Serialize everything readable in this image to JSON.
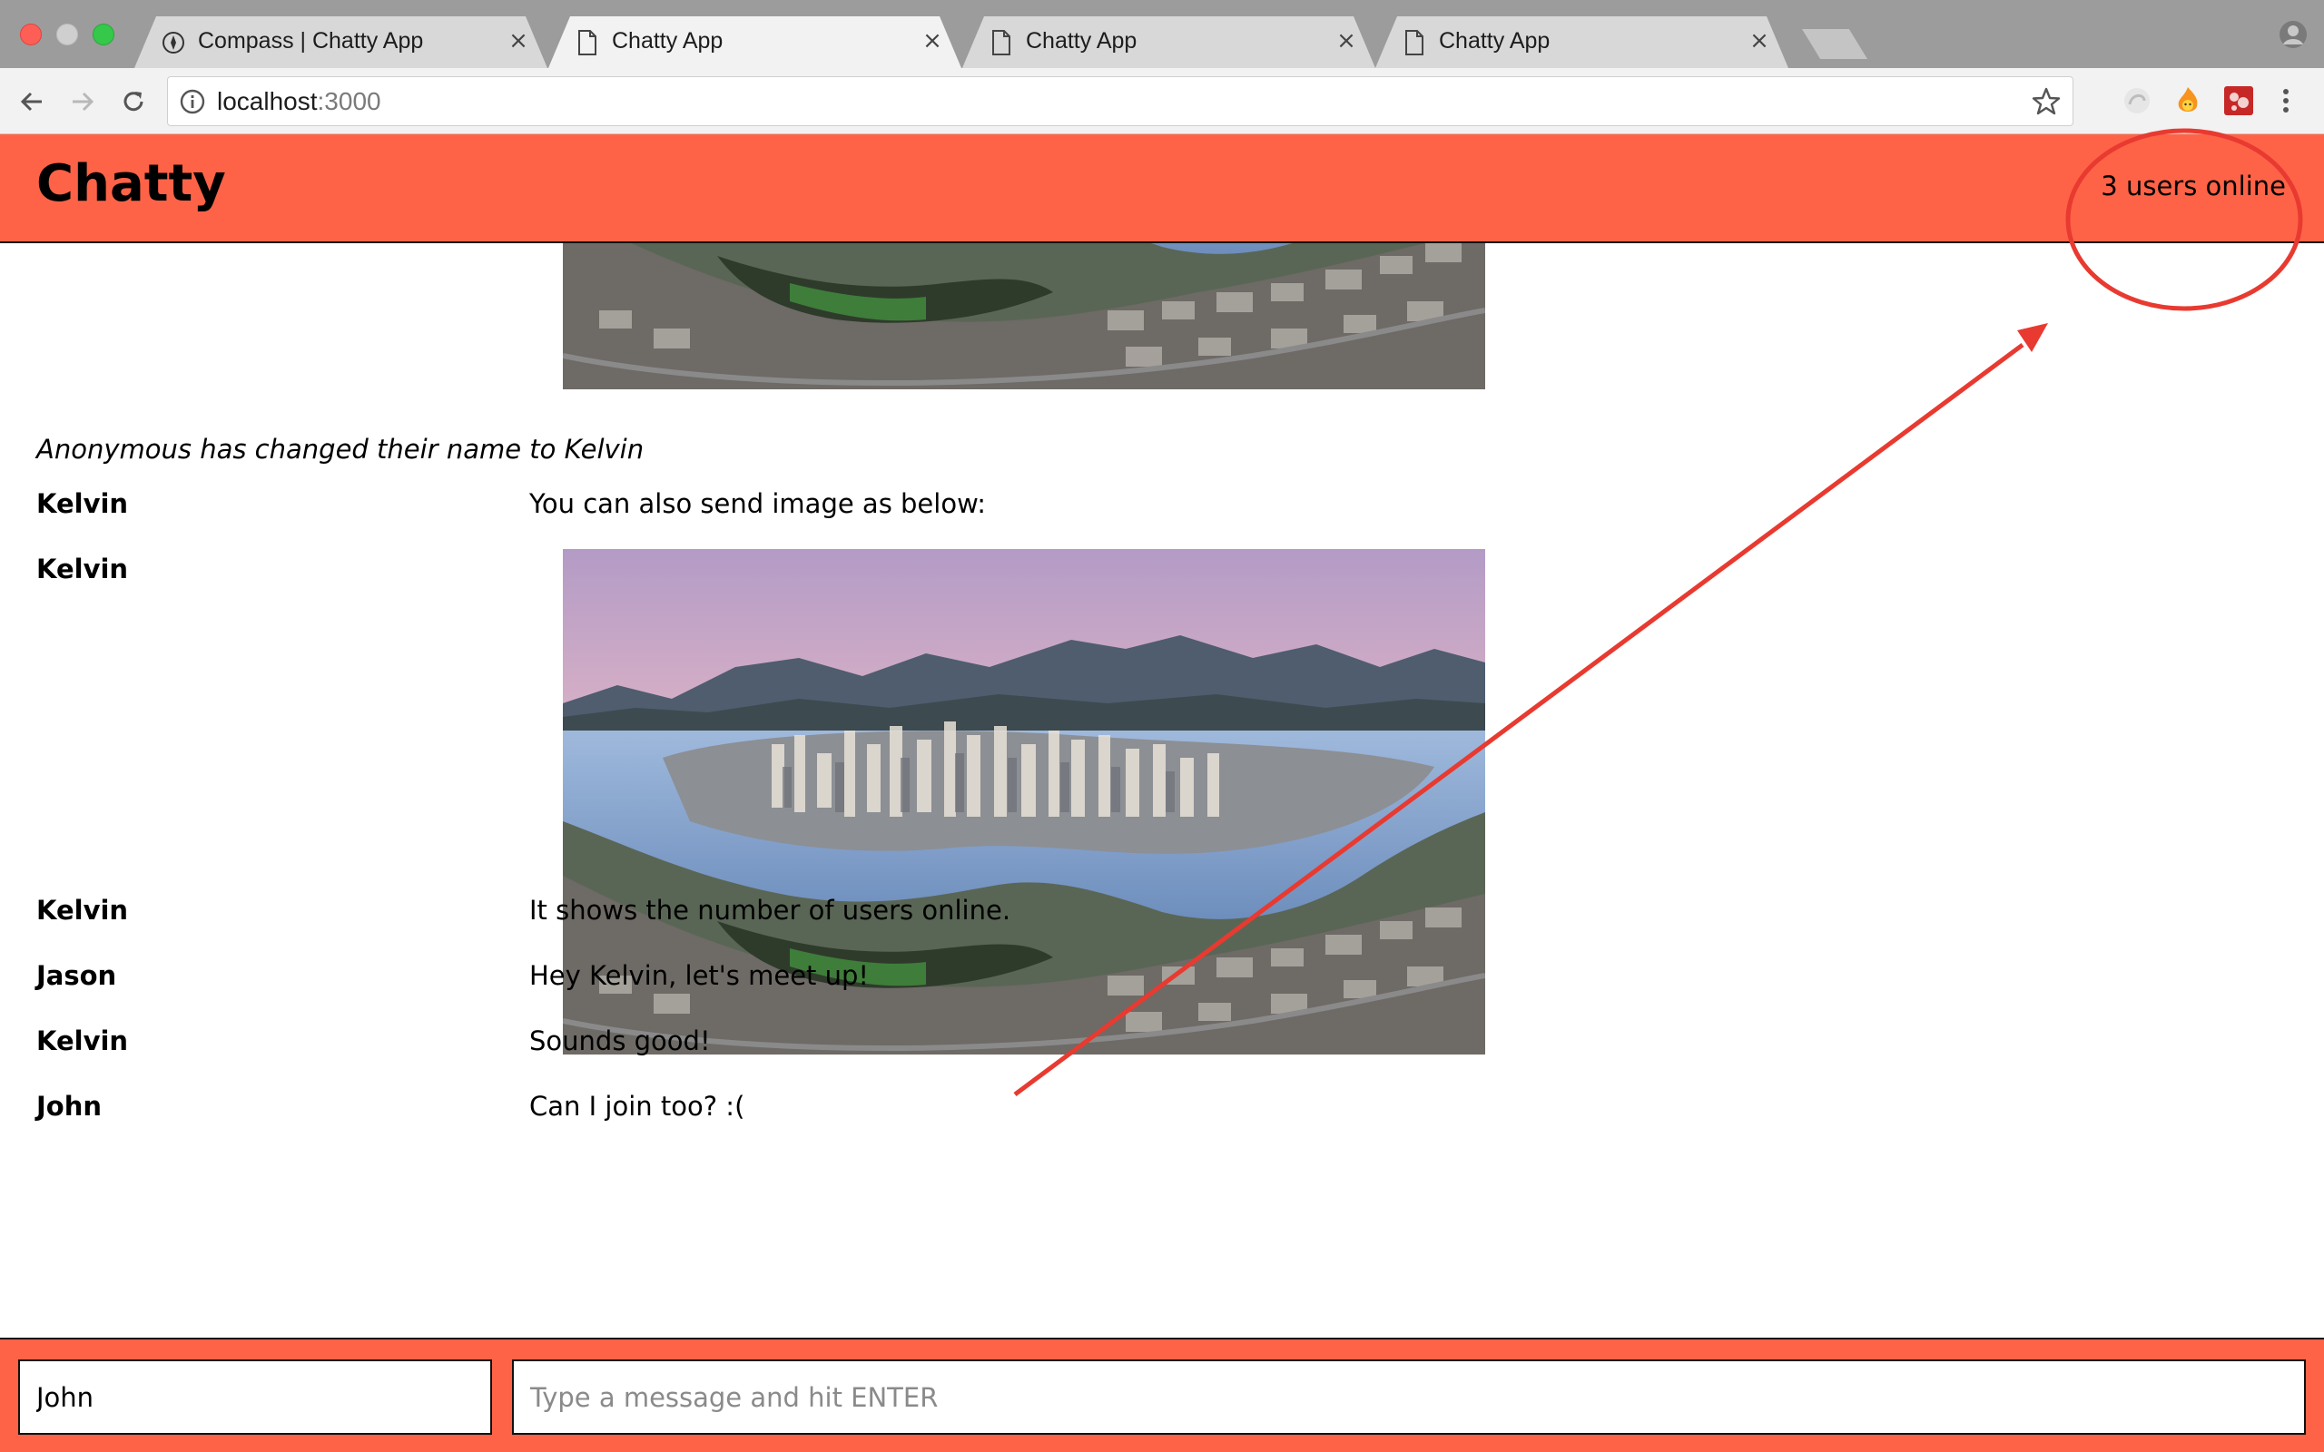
{
  "browser": {
    "tabs": [
      {
        "title": "Compass | Chatty App",
        "icon": "compass-icon",
        "active": false
      },
      {
        "title": "Chatty App",
        "icon": "document-icon",
        "active": true
      },
      {
        "title": "Chatty App",
        "icon": "document-icon",
        "active": false
      },
      {
        "title": "Chatty App",
        "icon": "document-icon",
        "active": false
      }
    ],
    "url": {
      "host": "localhost",
      "port": ":3000"
    }
  },
  "navbar": {
    "brand": "Chatty",
    "user_count": "3 users online"
  },
  "messages": [
    {
      "type": "image",
      "username": "",
      "image": "vancouver-panorama"
    },
    {
      "type": "notification",
      "content": "Anonymous has changed their name to Kelvin"
    },
    {
      "type": "text",
      "username": "Kelvin",
      "content": "You can also send image as below:"
    },
    {
      "type": "image",
      "username": "Kelvin",
      "image": "vancouver-panorama"
    },
    {
      "type": "text",
      "username": "Kelvin",
      "content": "It shows the number of users online."
    },
    {
      "type": "text",
      "username": "Jason",
      "content": "Hey Kelvin, let's meet up!"
    },
    {
      "type": "text",
      "username": "Kelvin",
      "content": "Sounds good!"
    },
    {
      "type": "text",
      "username": "John",
      "content": "Can I join too? :("
    }
  ],
  "chatbar": {
    "username_value": "John",
    "message_placeholder": "Type a message and hit ENTER"
  },
  "colors": {
    "app_accent": "#ff6347",
    "annotation": "#e83a30",
    "tabstrip": "#9c9c9c",
    "toolbar": "#f2f2f2"
  }
}
